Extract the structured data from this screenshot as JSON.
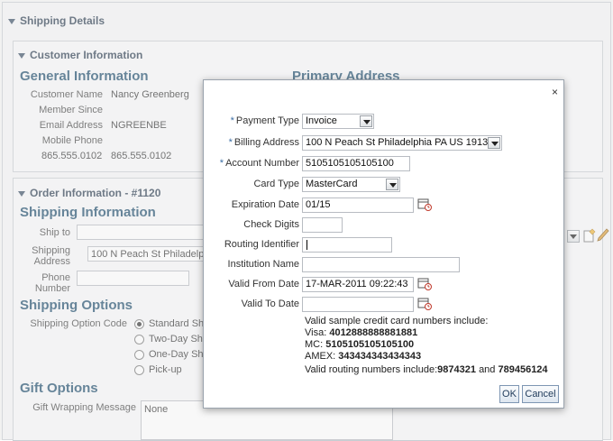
{
  "page": {
    "title": "Shipping Details"
  },
  "customer": {
    "section_title": "Customer Information",
    "general_heading": "General Information",
    "primary_heading": "Primary Address",
    "name_label": "Customer Name",
    "name_value": "Nancy Greenberg",
    "member_since_label": "Member Since",
    "email_label": "Email Address",
    "email_value": "NGREENBE",
    "mobile_label": "Mobile Phone",
    "phone_1": "865.555.0102",
    "phone_2": "865.555.0102"
  },
  "order": {
    "section_title": "Order Information - #1120",
    "shipping_heading": "Shipping Information",
    "ship_to_label": "Ship to",
    "shipping_address_label": "Shipping Address",
    "shipping_address_value": "100 N Peach St Philadelphi",
    "phone_number_label": "Phone Number",
    "options_heading": "Shipping Options",
    "option_code_label": "Shipping Option Code",
    "options": [
      "Standard Shi",
      "Two-Day Ship",
      "One-Day Ship",
      "Pick-up"
    ],
    "gift_heading": "Gift Options",
    "gift_wrap_label": "Gift Wrapping Message",
    "gift_wrap_value": "None"
  },
  "dialog": {
    "payment_type_label": "Payment Type",
    "payment_type_value": "Invoice",
    "billing_address_label": "Billing Address",
    "billing_address_value": "100 N Peach St Philadelphia PA US 19139",
    "account_number_label": "Account Number",
    "account_number_value": "5105105105105100",
    "card_type_label": "Card Type",
    "card_type_value": "MasterCard",
    "expiration_label": "Expiration Date",
    "expiration_value": "01/15",
    "check_digits_label": "Check Digits",
    "routing_label": "Routing Identifier",
    "institution_label": "Institution Name",
    "valid_from_label": "Valid From Date",
    "valid_from_value": "17-MAR-2011 09:22:43",
    "valid_to_label": "Valid To Date",
    "note_intro": "Valid sample credit card numbers include:",
    "visa_label": "Visa:",
    "visa_value": "4012888888881881",
    "mc_label": "MC:",
    "mc_value": "5105105105105100",
    "amex_label": "AMEX:",
    "amex_value": "343434343434343",
    "routing_note": "Valid routing numbers include:",
    "routing_1": "9874321",
    "routing_and": "and",
    "routing_2": "789456124",
    "ok_label": "OK",
    "cancel_label": "Cancel",
    "close_symbol": "×",
    "required_marker": "*"
  }
}
